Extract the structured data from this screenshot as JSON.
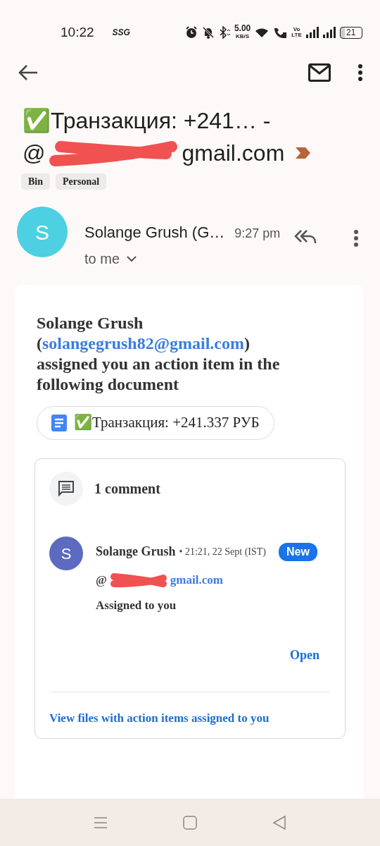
{
  "status_bar": {
    "time": "10:22",
    "carrier": "SSG",
    "speed": "5.00",
    "speed_unit": "KB/S",
    "network_top": "Vo",
    "network_bottom": "LTE",
    "battery": "21"
  },
  "subject": {
    "line_1": "✅Транзакция: +241… -",
    "line_2_start": "@",
    "line_2_end": "gmail.com"
  },
  "labels": [
    "Bin",
    "Personal"
  ],
  "message": {
    "avatar": "S",
    "sender": "Solange Grush (G…",
    "time": "9:27 pm",
    "recipient": "to me",
    "expanded": false
  },
  "body": {
    "intro_before": "Solange Grush (",
    "intro_link": "solangegrush82@gmail.com",
    "intro_after": ") assigned you an action item in the following document",
    "document": "✅Транзакция: +241.337 РУБ"
  },
  "comments": {
    "count": "1 comment",
    "items": [
      {
        "avatar": "S",
        "author": "Solange Grush",
        "time": "• 21:21, 22 Sept (IST)",
        "badge": "New",
        "mention_start": "@",
        "mention_end": "gmail.com",
        "text": "Assigned to you",
        "action": "Open"
      }
    ],
    "footer_link": "View files with action items assigned to you"
  }
}
